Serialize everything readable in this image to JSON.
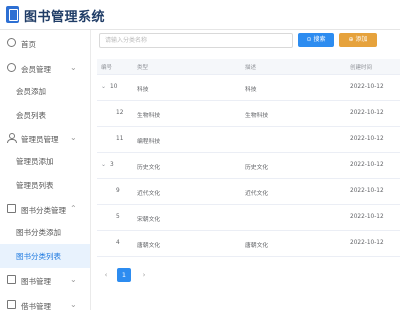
{
  "app": {
    "title": "图书管理系统"
  },
  "sidebar": {
    "home": "首页",
    "member_group": "会员管理",
    "member_add": "会员添加",
    "member_list": "会员列表",
    "admin_group": "管理员管理",
    "admin_add": "管理员添加",
    "admin_list": "管理员列表",
    "category_group": "图书分类管理",
    "category_add": "图书分类添加",
    "category_list": "图书分类列表",
    "book_group": "图书管理",
    "borrow_group": "借书管理"
  },
  "toolbar": {
    "search_placeholder": "请输入分类名称",
    "search_label": "搜索",
    "add_label": "添加"
  },
  "table": {
    "headers": [
      "编号",
      "类型",
      "描述",
      "创建时间"
    ],
    "rows": [
      {
        "id": "10",
        "type": "科技",
        "desc": "科技",
        "created": "2022-10-12",
        "level": 0,
        "expanded": true
      },
      {
        "id": "12",
        "type": "生物科技",
        "desc": "生物科技",
        "created": "2022-10-12",
        "level": 1
      },
      {
        "id": "11",
        "type": "编程科技",
        "desc": "",
        "created": "2022-10-12",
        "level": 1
      },
      {
        "id": "3",
        "type": "历史文化",
        "desc": "历史文化",
        "created": "2022-10-12",
        "level": 0,
        "expanded": true
      },
      {
        "id": "9",
        "type": "近代文化",
        "desc": "近代文化",
        "created": "2022-10-12",
        "level": 1
      },
      {
        "id": "5",
        "type": "宋朝文化",
        "desc": "",
        "created": "2022-10-12",
        "level": 1
      },
      {
        "id": "4",
        "type": "唐朝文化",
        "desc": "唐朝文化",
        "created": "2022-10-12",
        "level": 1
      }
    ]
  },
  "pagination": {
    "current": "1",
    "prev": "‹",
    "next": "›"
  },
  "colors": {
    "primary": "#2d8cf0",
    "warning": "#e6a23c",
    "active_bg": "#e8f2fd",
    "brand": "#2d6fd3"
  }
}
